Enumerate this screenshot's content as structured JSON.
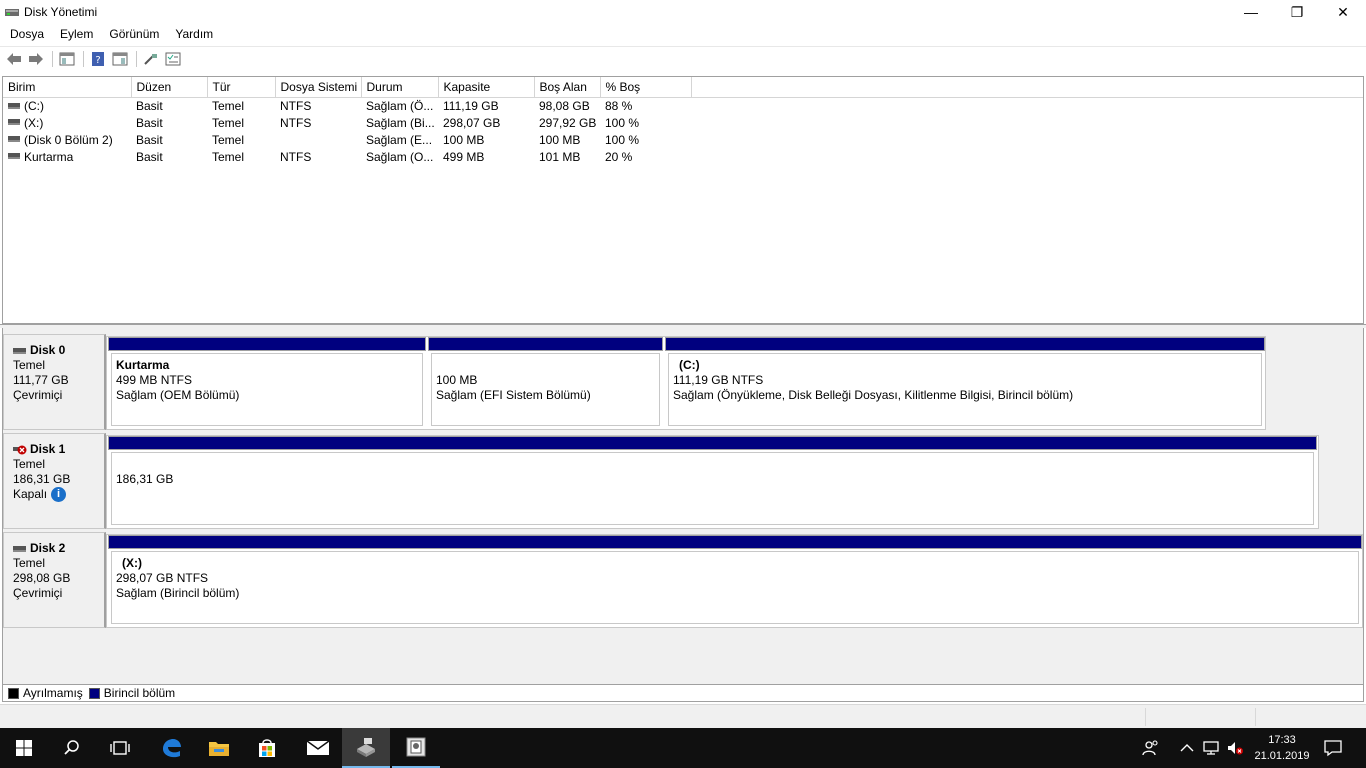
{
  "window": {
    "title": "Disk Yönetimi",
    "minimize_glyph": "—",
    "restore_glyph": "❐",
    "close_glyph": "✕"
  },
  "menu": [
    "Dosya",
    "Eylem",
    "Görünüm",
    "Yardım"
  ],
  "toolbar": [
    "back-icon",
    "forward-icon",
    "console-tree-icon",
    "help-icon",
    "properties-icon",
    "connect-icon",
    "checklist-icon"
  ],
  "volume_table": {
    "columns": [
      "Birim",
      "Düzen",
      "Tür",
      "Dosya Sistemi",
      "Durum",
      "Kapasite",
      "Boş Alan",
      "% Boş"
    ],
    "rows": [
      [
        "(C:)",
        "Basit",
        "Temel",
        "NTFS",
        "Sağlam (Ö...",
        "111,19 GB",
        "98,08 GB",
        "88 %"
      ],
      [
        "(X:)",
        "Basit",
        "Temel",
        "NTFS",
        "Sağlam (Bi...",
        "298,07 GB",
        "297,92 GB",
        "100 %"
      ],
      [
        "(Disk 0 Bölüm 2)",
        "Basit",
        "Temel",
        "",
        "Sağlam (E...",
        "100 MB",
        "100 MB",
        "100 %"
      ],
      [
        "Kurtarma",
        "Basit",
        "Temel",
        "NTFS",
        "Sağlam (O...",
        "499 MB",
        "101 MB",
        "20 %"
      ]
    ]
  },
  "disks": [
    {
      "name": "Disk 0",
      "type": "Temel",
      "size": "111,77 GB",
      "status": "Çevrimiçi",
      "partitions": [
        {
          "name": "Kurtarma",
          "size": "499 MB NTFS",
          "state": "Sağlam (OEM Bölümü)"
        },
        {
          "name": "",
          "size": "100 MB",
          "state": "Sağlam (EFI Sistem Bölümü)"
        },
        {
          "name": "(C:)",
          "size": "111,19 GB NTFS",
          "state": "Sağlam (Önyükleme, Disk Belleği Dosyası, Kilitlenme Bilgisi, Birincil bölüm)"
        }
      ]
    },
    {
      "name": "Disk 1",
      "type": "Temel",
      "size": "186,31 GB",
      "status": "Kapalı",
      "partitions": [
        {
          "name": "",
          "size": "186,31 GB",
          "state": ""
        }
      ]
    },
    {
      "name": "Disk 2",
      "type": "Temel",
      "size": "298,08 GB",
      "status": "Çevrimiçi",
      "partitions": [
        {
          "name": "(X:)",
          "size": "298,07 GB NTFS",
          "state": "Sağlam (Birincil bölüm)"
        }
      ]
    }
  ],
  "legend": [
    {
      "label": "Ayrılmamış",
      "color": "#000000"
    },
    {
      "label": "Birincil bölüm",
      "color": "#00007f"
    }
  ],
  "colors": {
    "primary_partition": "#00007f",
    "taskbar": "#101010"
  },
  "taskbar": {
    "apps": [
      "windows-start-icon",
      "search-icon",
      "task-view-icon",
      "edge-icon",
      "file-explorer-icon",
      "store-icon",
      "mail-icon",
      "disk-management-icon",
      "app-icon"
    ],
    "time": "17:33",
    "date": "21.01.2019"
  }
}
